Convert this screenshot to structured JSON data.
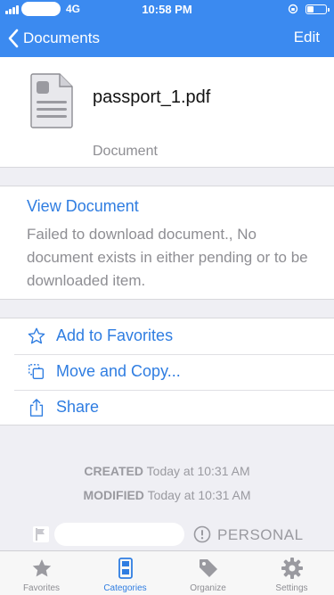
{
  "status_bar": {
    "network": "4G",
    "time": "10:58 PM"
  },
  "nav": {
    "back_label": "Documents",
    "edit_label": "Edit"
  },
  "document": {
    "name": "passport_1.pdf",
    "type": "Document"
  },
  "view": {
    "link_label": "View Document",
    "error": "Failed to download document., No document exists in either pending or to be downloaded item."
  },
  "actions": [
    {
      "label": "Add to Favorites",
      "icon": "star-icon"
    },
    {
      "label": "Move and Copy...",
      "icon": "move-copy-icon"
    },
    {
      "label": "Share",
      "icon": "share-icon"
    }
  ],
  "meta": {
    "created_label": "CREATED",
    "created_value": "Today at 10:31 AM",
    "modified_label": "MODIFIED",
    "modified_value": "Today at 10:31 AM"
  },
  "tag": {
    "label": "PERSONAL"
  },
  "tabs": [
    {
      "label": "Favorites",
      "icon": "star-icon"
    },
    {
      "label": "Categories",
      "icon": "categories-icon",
      "active": true
    },
    {
      "label": "Organize",
      "icon": "tag-icon"
    },
    {
      "label": "Settings",
      "icon": "gear-icon"
    }
  ],
  "colors": {
    "brand": "#3b8af0",
    "link": "#2f7de1",
    "muted": "#8e8e93",
    "background": "#efeff4"
  }
}
